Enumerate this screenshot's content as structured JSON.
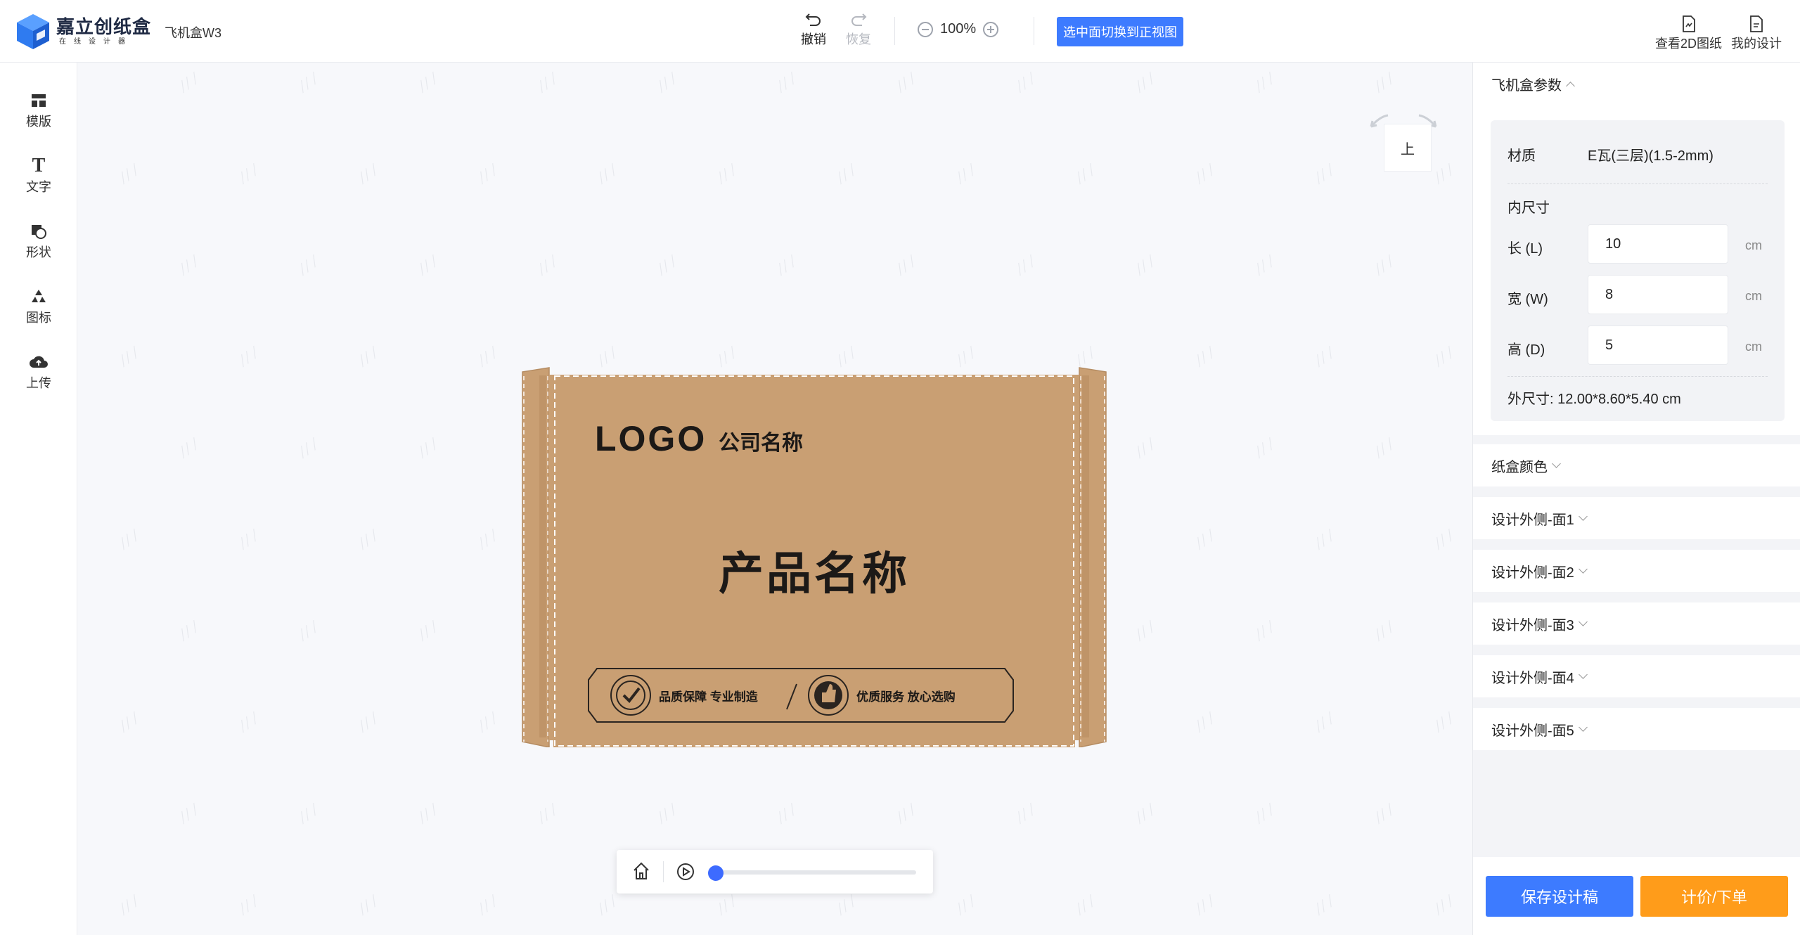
{
  "app": {
    "logo_text": "嘉立创纸盒",
    "logo_sub": "在线设计器",
    "product_name": "飞机盒W3"
  },
  "toolbar": {
    "undo_label": "撤销",
    "redo_label": "恢复",
    "zoom_value": "100%",
    "switch_view_label": "选中面切换到正视图",
    "view_2d_label": "查看2D图纸",
    "my_design_label": "我的设计"
  },
  "leftbar": {
    "items": [
      {
        "label": "模版",
        "icon": "template-icon"
      },
      {
        "label": "文字",
        "icon": "text-icon"
      },
      {
        "label": "形状",
        "icon": "shape-icon"
      },
      {
        "label": "图标",
        "icon": "recycle-icon"
      },
      {
        "label": "上传",
        "icon": "cloud-upload-icon"
      }
    ]
  },
  "canvas": {
    "view_cube_face": "上",
    "box": {
      "logo_text": "LOGO",
      "company_name": "公司名称",
      "product_title": "产品名称",
      "badge_left": "品质保障 专业制造",
      "badge_right": "优质服务 放心选购",
      "color": "#c99f73"
    },
    "playback_progress": 0
  },
  "panel": {
    "params_title": "飞机盒参数",
    "material_label": "材质",
    "material_value": "E瓦(三层)(1.5-2mm)",
    "inner_size_label": "内尺寸",
    "length_label": "长 (L)",
    "length_value": "10",
    "width_label": "宽 (W)",
    "width_value": "8",
    "height_label": "高 (D)",
    "height_value": "5",
    "unit": "cm",
    "outer_size": "外尺寸: 12.00*8.60*5.40 cm",
    "sections": [
      "纸盒颜色",
      "设计外侧-面1",
      "设计外侧-面2",
      "设计外侧-面3",
      "设计外侧-面4",
      "设计外侧-面5"
    ],
    "save_label": "保存设计稿",
    "order_label": "计价/下单"
  },
  "colors": {
    "primary": "#3d7bff",
    "order": "#ff9c1a",
    "kraft": "#c99f73"
  }
}
